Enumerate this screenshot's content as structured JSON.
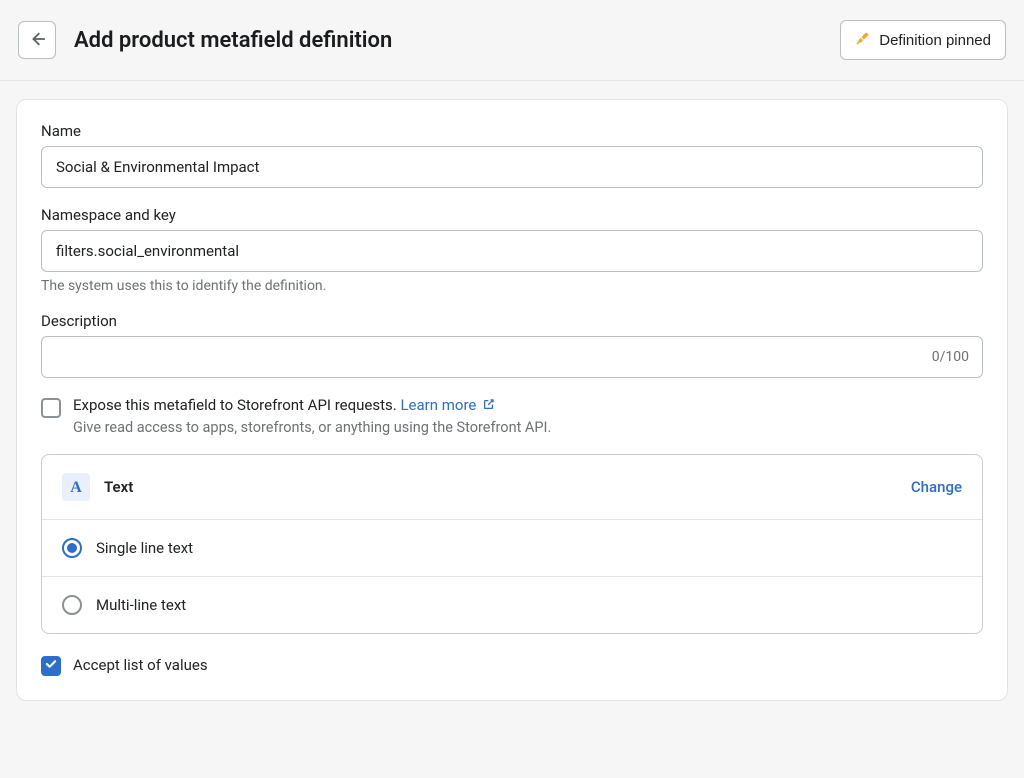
{
  "header": {
    "title": "Add product metafield definition",
    "pin_button_label": "Definition pinned"
  },
  "form": {
    "name": {
      "label": "Name",
      "value": "Social & Environmental Impact"
    },
    "namespace_key": {
      "label": "Namespace and key",
      "value": "filters.social_environmental",
      "help": "The system uses this to identify the definition."
    },
    "description": {
      "label": "Description",
      "value": "",
      "counter": "0/100"
    },
    "expose_api": {
      "checked": false,
      "label_prefix": "Expose this metafield to Storefront API requests. ",
      "learn_more": "Learn more",
      "sub": "Give read access to apps, storefronts, or anything using the Storefront API."
    },
    "type_section": {
      "type_name": "Text",
      "change_label": "Change",
      "options": [
        {
          "label": "Single line text",
          "selected": true
        },
        {
          "label": "Multi-line text",
          "selected": false
        }
      ]
    },
    "accept_list": {
      "checked": true,
      "label": "Accept list of values"
    }
  }
}
